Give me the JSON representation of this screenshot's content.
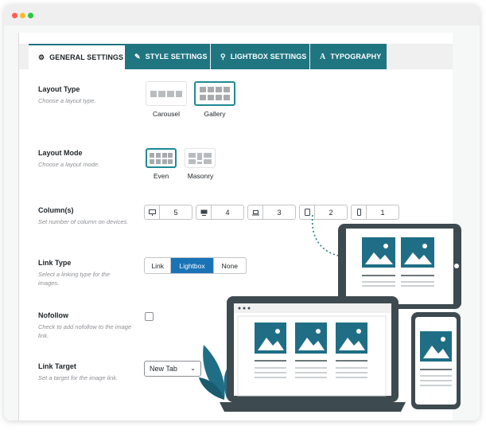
{
  "window": {
    "dots": [
      "#ff5f57",
      "#febc2e",
      "#28c840"
    ]
  },
  "tabs": [
    {
      "label": "GENERAL SETTINGS",
      "icon": "gear-icon",
      "glyph": "⚙",
      "active": true
    },
    {
      "label": "STYLE SETTINGS",
      "icon": "brush-icon",
      "glyph": "✎",
      "active": false
    },
    {
      "label": "LIGHTBOX SETTINGS",
      "icon": "search-icon",
      "glyph": "⚲",
      "active": false
    },
    {
      "label": "TYPOGRAPHY",
      "icon": "font-icon",
      "glyph": "A",
      "active": false
    }
  ],
  "layout_type": {
    "label": "Layout Type",
    "desc": "Choose a layout type.",
    "options": [
      "Carousel",
      "Gallery"
    ],
    "selected": "Gallery"
  },
  "layout_mode": {
    "label": "Layout Mode",
    "desc": "Choose a layout mode.",
    "options": [
      "Even",
      "Masonry"
    ],
    "selected": "Even"
  },
  "columns": {
    "label": "Column(s)",
    "desc": "Set number of column on devices.",
    "devices": [
      {
        "icon": "desktop-icon",
        "value": "5"
      },
      {
        "icon": "monitor-icon",
        "value": "4"
      },
      {
        "icon": "laptop-icon",
        "value": "3"
      },
      {
        "icon": "tablet-icon",
        "value": "2"
      },
      {
        "icon": "mobile-icon",
        "value": "1"
      }
    ],
    "help": "?"
  },
  "link_type": {
    "label": "Link Type",
    "desc": "Select a linking type for the images.",
    "options": [
      "Link",
      "Lightbox",
      "None"
    ],
    "selected": "Lightbox"
  },
  "nofollow": {
    "label": "Nofollow",
    "desc": "Check to add nofollow to the image link.",
    "checked": false
  },
  "link_target": {
    "label": "Link Target",
    "desc": "Set a target for the image link.",
    "value": "New Tab",
    "arrow": "⌄"
  },
  "colors": {
    "accent": "#1f7580",
    "selected_blue": "#1a73b7",
    "device_dark": "#3d4a4f",
    "image_teal": "#1f6e86"
  }
}
